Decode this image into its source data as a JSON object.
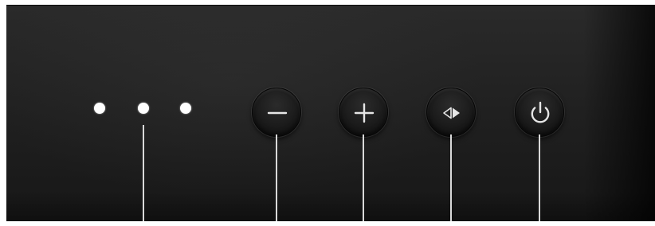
{
  "panel": {
    "background_color": "#1f1f1f",
    "line_color": "#d9d9d9",
    "indicator_color": "#ffffff"
  },
  "indicators": [
    {
      "name": "indicator-light-1",
      "lit": true
    },
    {
      "name": "indicator-light-2",
      "lit": true
    },
    {
      "name": "indicator-light-3",
      "lit": true
    }
  ],
  "buttons": [
    {
      "name": "minus-button",
      "icon": "minus-icon"
    },
    {
      "name": "plus-button",
      "icon": "plus-icon"
    },
    {
      "name": "input-switch-button",
      "icon": "input-switch-icon"
    },
    {
      "name": "power-button",
      "icon": "power-icon"
    }
  ]
}
